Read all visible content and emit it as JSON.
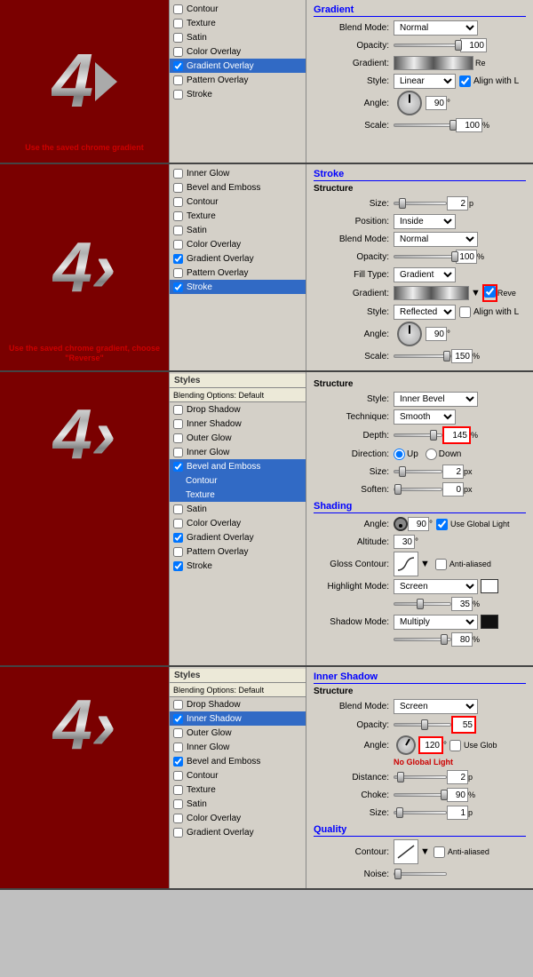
{
  "panels": [
    {
      "id": "panel1",
      "section_title": "Gradient",
      "note": "Use the saved chrome gradient",
      "active_item": "Gradient Overlay",
      "style_items": [
        {
          "label": "Contour",
          "checked": false,
          "sub": false
        },
        {
          "label": "Texture",
          "checked": false,
          "sub": false
        },
        {
          "label": "Satin",
          "checked": false,
          "sub": false
        },
        {
          "label": "Color Overlay",
          "checked": false,
          "sub": false
        },
        {
          "label": "Gradient Overlay",
          "checked": true,
          "sub": false,
          "active": true
        },
        {
          "label": "Pattern Overlay",
          "checked": false,
          "sub": false
        },
        {
          "label": "Stroke",
          "checked": false,
          "sub": false
        }
      ],
      "settings": {
        "blend_mode_label": "Blend Mode:",
        "blend_mode_value": "Normal",
        "opacity_label": "Opacity:",
        "opacity_value": "100",
        "gradient_label": "Gradient:",
        "style_label": "Style:",
        "style_value": "Linear",
        "align_label": "Align with L",
        "angle_label": "Angle:",
        "angle_value": "90",
        "scale_label": "Scale:",
        "scale_value": "100"
      }
    },
    {
      "id": "panel2",
      "section_title": "Stroke",
      "note": "Use the saved chrome gradient, choose \"Reverse\"",
      "active_item": "Stroke",
      "style_items": [
        {
          "label": "Inner Glow",
          "checked": false,
          "sub": false
        },
        {
          "label": "Bevel and Emboss",
          "checked": false,
          "sub": false
        },
        {
          "label": "Contour",
          "checked": false,
          "sub": false
        },
        {
          "label": "Texture",
          "checked": false,
          "sub": false
        },
        {
          "label": "Satin",
          "checked": false,
          "sub": false
        },
        {
          "label": "Color Overlay",
          "checked": false,
          "sub": false
        },
        {
          "label": "Gradient Overlay",
          "checked": true,
          "sub": false
        },
        {
          "label": "Pattern Overlay",
          "checked": false,
          "sub": false
        },
        {
          "label": "Stroke",
          "checked": true,
          "sub": false,
          "active": true
        }
      ],
      "settings": {
        "structure_header": "Structure",
        "size_label": "Size:",
        "size_value": "2",
        "position_label": "Position:",
        "position_value": "Inside",
        "blend_mode_label": "Blend Mode:",
        "blend_mode_value": "Normal",
        "opacity_label": "Opacity:",
        "opacity_value": "100",
        "fill_type_label": "Fill Type:",
        "fill_type_value": "Gradient",
        "gradient_label": "Gradient:",
        "reverse_label": "Reve",
        "style_label": "Style:",
        "style_value": "Reflected",
        "align_label": "Align with L",
        "angle_label": "Angle:",
        "angle_value": "90",
        "scale_label": "Scale:",
        "scale_value": "150"
      }
    },
    {
      "id": "panel3",
      "section_title": "Structure",
      "active_item": "Bevel and Emboss",
      "styles_header": "Styles",
      "blending_options": "Blending Options: Default",
      "style_items": [
        {
          "label": "Drop Shadow",
          "checked": false,
          "sub": false
        },
        {
          "label": "Inner Shadow",
          "checked": false,
          "sub": false
        },
        {
          "label": "Outer Glow",
          "checked": false,
          "sub": false
        },
        {
          "label": "Inner Glow",
          "checked": false,
          "sub": false
        },
        {
          "label": "Bevel and Emboss",
          "checked": true,
          "sub": false,
          "active": true
        },
        {
          "label": "Contour",
          "checked": false,
          "sub": true
        },
        {
          "label": "Texture",
          "checked": false,
          "sub": true
        },
        {
          "label": "Satin",
          "checked": false,
          "sub": false
        },
        {
          "label": "Color Overlay",
          "checked": false,
          "sub": false
        },
        {
          "label": "Gradient Overlay",
          "checked": true,
          "sub": false
        },
        {
          "label": "Pattern Overlay",
          "checked": false,
          "sub": false
        },
        {
          "label": "Stroke",
          "checked": true,
          "sub": false
        }
      ],
      "settings": {
        "style_label": "Style:",
        "style_value": "Inner Bevel",
        "technique_label": "Technique:",
        "technique_value": "Smooth",
        "depth_label": "Depth:",
        "depth_value": "145",
        "percent_label": "%",
        "direction_label": "Direction:",
        "direction_up": "Up",
        "direction_down": "Down",
        "size_label": "Size:",
        "size_value": "2",
        "px1": "px",
        "soften_label": "Soften:",
        "soften_value": "0",
        "px2": "px",
        "shading_header": "Shading",
        "angle_label": "Angle:",
        "angle_value": "90",
        "use_global": "Use Global Light",
        "altitude_label": "Altitude:",
        "altitude_value": "30",
        "gloss_label": "Gloss Contour:",
        "anti_aliased": "Anti-aliased",
        "highlight_label": "Highlight Mode:",
        "highlight_value": "Screen",
        "highlight_opacity": "35",
        "shadow_label": "Shadow Mode:",
        "shadow_value": "Multiply",
        "shadow_opacity": "80"
      }
    },
    {
      "id": "panel4",
      "section_title": "Inner Shadow",
      "active_item": "Inner Shadow",
      "styles_header": "Styles",
      "blending_options": "Blending Options: Default",
      "style_items": [
        {
          "label": "Drop Shadow",
          "checked": false,
          "sub": false
        },
        {
          "label": "Inner Shadow",
          "checked": true,
          "sub": false,
          "active": true
        },
        {
          "label": "Outer Glow",
          "checked": false,
          "sub": false
        },
        {
          "label": "Inner Glow",
          "checked": false,
          "sub": false
        },
        {
          "label": "Bevel and Emboss",
          "checked": true,
          "sub": false
        },
        {
          "label": "Contour",
          "checked": false,
          "sub": false
        },
        {
          "label": "Texture",
          "checked": false,
          "sub": false
        },
        {
          "label": "Satin",
          "checked": false,
          "sub": false
        },
        {
          "label": "Color Overlay",
          "checked": false,
          "sub": false
        },
        {
          "label": "Gradient Overlay",
          "checked": false,
          "sub": false
        }
      ],
      "settings": {
        "structure_header": "Structure",
        "blend_mode_label": "Blend Mode:",
        "blend_mode_value": "Screen",
        "opacity_label": "Opacity:",
        "opacity_value": "55",
        "angle_label": "Angle:",
        "angle_value": "120",
        "no_global": "No Global Light",
        "use_global": "Use Glob",
        "distance_label": "Distance:",
        "distance_value": "2",
        "choke_label": "Choke:",
        "choke_value": "90",
        "size_label": "Size:",
        "size_value": "1",
        "quality_header": "Quality",
        "contour_label": "Contour:",
        "anti_aliased": "Anti-aliased",
        "noise_label": "Noise:"
      }
    }
  ],
  "icons": {
    "checkbox_checked": "✓",
    "dropdown": "▼"
  }
}
